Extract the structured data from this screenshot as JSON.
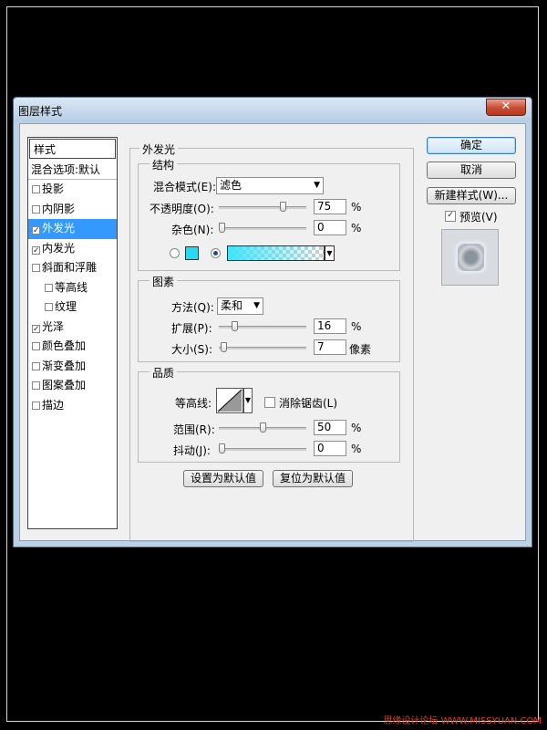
{
  "window": {
    "title": "图层样式",
    "close_label": "✕"
  },
  "style_list": {
    "header": "样式",
    "blend_options": "混合选项:默认",
    "items": [
      {
        "label": "投影",
        "checked": false,
        "sub": false,
        "selected": false
      },
      {
        "label": "内阴影",
        "checked": false,
        "sub": false,
        "selected": false
      },
      {
        "label": "外发光",
        "checked": true,
        "sub": false,
        "selected": true
      },
      {
        "label": "内发光",
        "checked": true,
        "sub": false,
        "selected": false
      },
      {
        "label": "斜面和浮雕",
        "checked": false,
        "sub": false,
        "selected": false
      },
      {
        "label": "等高线",
        "checked": false,
        "sub": true,
        "selected": false
      },
      {
        "label": "纹理",
        "checked": false,
        "sub": true,
        "selected": false
      },
      {
        "label": "光泽",
        "checked": true,
        "sub": false,
        "selected": false
      },
      {
        "label": "颜色叠加",
        "checked": false,
        "sub": false,
        "selected": false
      },
      {
        "label": "渐变叠加",
        "checked": false,
        "sub": false,
        "selected": false
      },
      {
        "label": "图案叠加",
        "checked": false,
        "sub": false,
        "selected": false
      },
      {
        "label": "描边",
        "checked": false,
        "sub": false,
        "selected": false
      }
    ]
  },
  "panel": {
    "title": "外发光",
    "structure": {
      "title": "结构",
      "blend_mode_label": "混合模式(E):",
      "blend_mode_value": "滤色",
      "opacity_label": "不透明度(O):",
      "opacity_value": "75",
      "opacity_unit": "%",
      "opacity_fraction": 0.75,
      "noise_label": "杂色(N):",
      "noise_value": "0",
      "noise_unit": "%",
      "noise_fraction": 0,
      "color_swatch": "#2bd8f2",
      "gradient_color": "#40e4fa",
      "color_mode": "gradient"
    },
    "elements": {
      "title": "图素",
      "technique_label": "方法(Q):",
      "technique_value": "柔和",
      "spread_label": "扩展(P):",
      "spread_value": "16",
      "spread_unit": "%",
      "spread_fraction": 0.16,
      "size_label": "大小(S):",
      "size_value": "7",
      "size_unit": "像素",
      "size_fraction": 0.028
    },
    "quality": {
      "title": "品质",
      "contour_label": "等高线:",
      "antialias_label": "消除锯齿(L)",
      "antialias_checked": false,
      "range_label": "范围(R):",
      "range_value": "50",
      "range_unit": "%",
      "range_fraction": 0.5,
      "jitter_label": "抖动(J):",
      "jitter_value": "0",
      "jitter_unit": "%",
      "jitter_fraction": 0
    },
    "make_default": "设置为默认值",
    "reset_default": "复位为默认值"
  },
  "buttons": {
    "ok": "确定",
    "cancel": "取消",
    "new_style": "新建样式(W)...",
    "preview_label": "预览(V)",
    "preview_checked": true
  },
  "watermark": "思缘设计论坛 WWW.MISSYUAN.COM"
}
